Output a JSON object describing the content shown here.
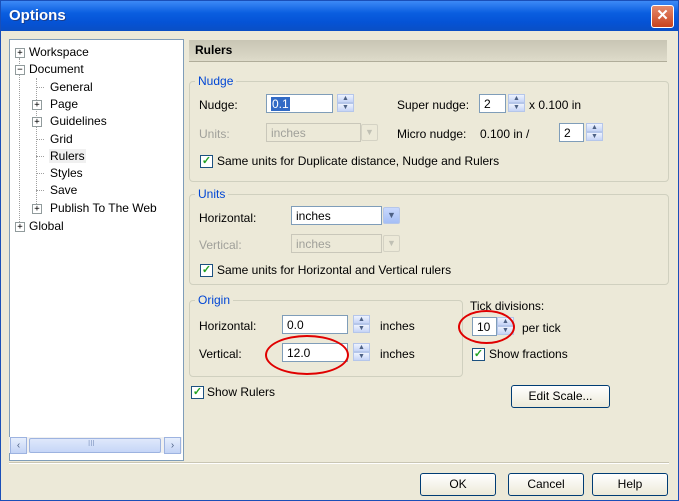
{
  "window": {
    "title": "Options"
  },
  "tree": {
    "items": [
      {
        "label": "Workspace",
        "expander": "+"
      },
      {
        "label": "Document",
        "expander": "−"
      },
      {
        "label": "General"
      },
      {
        "label": "Page",
        "expander": "+"
      },
      {
        "label": "Guidelines",
        "expander": "+"
      },
      {
        "label": "Grid"
      },
      {
        "label": "Rulers",
        "selected": true
      },
      {
        "label": "Styles"
      },
      {
        "label": "Save"
      },
      {
        "label": "Publish To The Web",
        "expander": "+"
      },
      {
        "label": "Global",
        "expander": "+"
      }
    ],
    "scroll_left": "‹",
    "scroll_right": "›",
    "scroll_grip": "III"
  },
  "panel": {
    "title": "Rulers"
  },
  "nudge": {
    "group_label": "Nudge",
    "nudge_label": "Nudge:",
    "nudge_value": "0.1",
    "super_label": "Super nudge:",
    "super_value": "2",
    "super_suffix": "x 0.100 in",
    "units_label": "Units:",
    "units_value": "inches",
    "micro_label": "Micro nudge:",
    "micro_text": "0.100 in /",
    "micro_value": "2",
    "same_units_label": "Same units for Duplicate distance, Nudge and Rulers",
    "same_units_checked": true
  },
  "units": {
    "group_label": "Units",
    "horizontal_label": "Horizontal:",
    "horizontal_value": "inches",
    "vertical_label": "Vertical:",
    "vertical_value": "inches",
    "same_units_label": "Same units for Horizontal and Vertical rulers",
    "same_units_checked": true
  },
  "origin": {
    "group_label": "Origin",
    "horizontal_label": "Horizontal:",
    "horizontal_value": "0.0",
    "horizontal_unit": "inches",
    "vertical_label": "Vertical:",
    "vertical_value": "12.0",
    "vertical_unit": "inches"
  },
  "tick": {
    "label": "Tick divisions:",
    "value": "10",
    "suffix": "per tick",
    "show_fractions_label": "Show fractions",
    "show_fractions_checked": true
  },
  "show_rulers": {
    "label": "Show Rulers",
    "checked": true
  },
  "edit_scale_label": "Edit Scale...",
  "footer": {
    "ok": "OK",
    "cancel": "Cancel",
    "help": "Help"
  },
  "glyphs": {
    "check": "✓",
    "arrow_up": "▲",
    "arrow_down": "▼",
    "close": "✕"
  },
  "colors": {
    "titlebar": "#0553d6",
    "group_label": "#0046d5",
    "highlight": "#e00000"
  }
}
